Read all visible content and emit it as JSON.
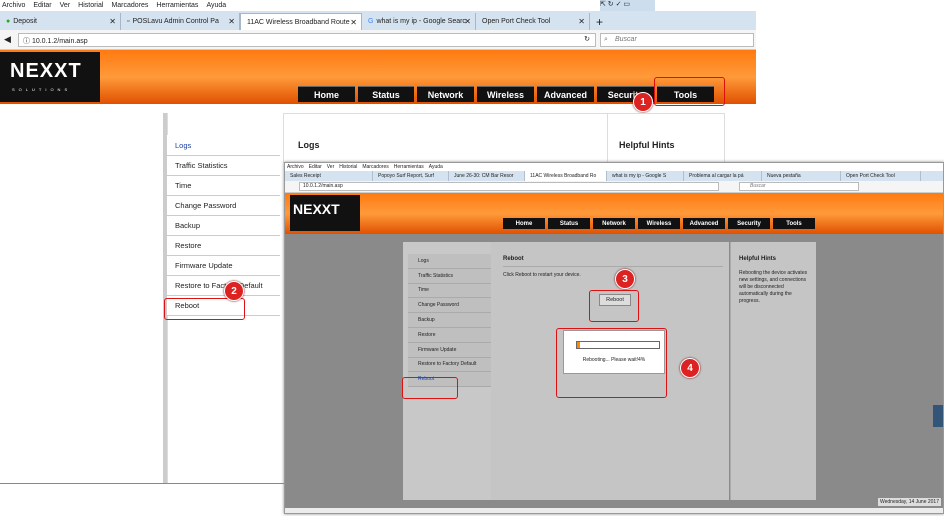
{
  "menu": [
    "Archivo",
    "Editar",
    "Ver",
    "Historial",
    "Marcadores",
    "Herramientas",
    "Ayuda"
  ],
  "tabs": [
    {
      "label": "Deposit"
    },
    {
      "label": "POSLavu Admin Control Pa"
    },
    {
      "label": "11AC Wireless Broadband Route"
    },
    {
      "label": "what is my ip - Google Searc"
    },
    {
      "label": "Open Port Check Tool"
    }
  ],
  "url": "10.0.1.2/main.asp",
  "search_placeholder": "Buscar",
  "logo": {
    "text": "NEXXT",
    "sub": "SOLUTIONS"
  },
  "nav": [
    "Home",
    "Status",
    "Network",
    "Wireless",
    "Advanced",
    "Security",
    "Tools"
  ],
  "sidebar": [
    "Logs",
    "Traffic Statistics",
    "Time",
    "Change Password",
    "Backup",
    "Restore",
    "Firmware Update",
    "Restore to Factory Default",
    "Reboot"
  ],
  "content": {
    "title": "Logs",
    "hints_title": "Helpful Hints"
  },
  "callouts": [
    "1",
    "2",
    "3",
    "4"
  ],
  "inner": {
    "menu": [
      "Archivo",
      "Editar",
      "Ver",
      "Historial",
      "Marcadores",
      "Herramientas",
      "Ayuda"
    ],
    "tabs": [
      "Sales Receipt",
      "Popoyo Surf Report, Surf",
      "June 26-30: CM Bar Resor",
      "11AC Wireless Broadband Ro",
      "what is my ip - Google S",
      "Problema al cargar la pá",
      "Nueva pestaña",
      "Open Port Check Tool"
    ],
    "url": "10.0.1.2/main.asp",
    "search": "Buscar",
    "nav": [
      "Home",
      "Status",
      "Network",
      "Wireless",
      "Advanced",
      "Security",
      "Tools"
    ],
    "sidebar": [
      "Logs",
      "Traffic Statistics",
      "Time",
      "Change Password",
      "Backup",
      "Restore",
      "Firmware Update",
      "Restore to Factory Default",
      "Reboot"
    ],
    "reboot_title": "Reboot",
    "reboot_desc": "Click Reboot to restart your device.",
    "reboot_button": "Reboot",
    "progress_text": "Rebooting... Please wait!4%",
    "progress": 0.04,
    "hints_title": "Helpful Hints",
    "hints_text": "Rebooting the device activates new settings, and connections will be disconnected automatically during the progress.",
    "status_date": "Wednesday, 14 June 2017"
  }
}
